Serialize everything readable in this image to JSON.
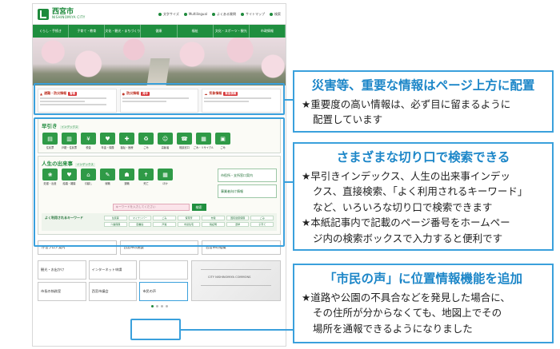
{
  "site": {
    "logo_title": "西宮市",
    "logo_sub": "NISHINOMIYA CITY",
    "top_links": [
      "文字サイズ",
      "Multilingual",
      "よくある質問",
      "サイトマップ",
      "検索"
    ],
    "nav": [
      "くらし・手続き",
      "子育て・教育",
      "文化・観光・まちづくり",
      "健康",
      "福祉",
      "文化・スポーツ・観光",
      "市政情報"
    ],
    "alerts": [
      {
        "head": "避難・防災情報",
        "tag": "警報"
      },
      {
        "head": "防災情報",
        "tag": "発令"
      },
      {
        "head": "気象情報",
        "tag": "緊急情報"
      }
    ],
    "hayabiki": {
      "title": "早引き",
      "title_en": "インデックス",
      "items": [
        {
          "label": "住民票",
          "glyph": "▤"
        },
        {
          "label": "戸籍・住民票",
          "glyph": "▥"
        },
        {
          "label": "税金",
          "glyph": "¥"
        },
        {
          "label": "年金・保険",
          "glyph": "♥"
        },
        {
          "label": "福祉・医療",
          "glyph": "✚"
        },
        {
          "label": "ごみ",
          "glyph": "♻"
        },
        {
          "label": "高齢者",
          "glyph": "☺"
        },
        {
          "label": "相談窓口",
          "glyph": "☎"
        },
        {
          "label": "ごみ・リサイクル",
          "glyph": "▦"
        },
        {
          "label": "ごみ",
          "glyph": "▣"
        }
      ]
    },
    "life": {
      "title": "人生の出来事",
      "title_en": "インデックス",
      "items": [
        {
          "label": "妊娠・出産",
          "glyph": "❀"
        },
        {
          "label": "結婚・離婚",
          "glyph": "♥"
        },
        {
          "label": "引越し",
          "glyph": "⌂"
        },
        {
          "label": "就職",
          "glyph": "✎"
        },
        {
          "label": "退職",
          "glyph": "☗"
        },
        {
          "label": "死亡",
          "glyph": "✝"
        },
        {
          "label": "ほか",
          "glyph": "▦"
        }
      ],
      "side_buttons": [
        "市役所・支所窓口案内",
        "事業者向け情報"
      ]
    },
    "search": {
      "placeholder": "キーワードを入力してください",
      "button": "検索"
    },
    "keywords": {
      "title": "よく利用されるキーワード",
      "items": [
        "住民票",
        "マイナンバー",
        "ごみ",
        "保育所",
        "市税",
        "国民健康保険",
        "ごみ",
        "介護保険",
        "図書館",
        "戸籍",
        "市営住宅",
        "税証明",
        "選挙",
        "子育て"
      ]
    },
    "quick": [
      "庁舎フロア案内",
      "西宮市の施設",
      "西宮市の組織"
    ],
    "bottom": [
      "観光・お出かけ",
      "インターネット申請",
      "",
      "市長の執務室",
      "西宮市議会",
      "市民の声"
    ],
    "map_label": "CITY NISHINOMIYA COMMONS"
  },
  "callouts": {
    "disaster": {
      "title": "災害等、重要な情報はページ上方に配置",
      "lines": [
        "★重要度の高い情報は、必ず目に留まるように",
        "配置しています"
      ]
    },
    "search": {
      "title": "さまざまな切り口で検索できる",
      "lines": [
        "★早引きインデックス、人生の出来事インデッ",
        "クス、直接検索、「よく利用されるキーワード」",
        "など、いろいろな切り口で検索できます",
        "★本紙記事内で記載のページ番号をホームペー",
        "ジ内の検索ボックスで入力すると便利です"
      ]
    },
    "voice": {
      "title": "「市民の声」に位置情報機能を追加",
      "lines": [
        "★道路や公園の不具合などを発見した場合に、",
        "その住所が分からなくても、地図上でその",
        "場所を通報できるようになりました"
      ]
    }
  }
}
